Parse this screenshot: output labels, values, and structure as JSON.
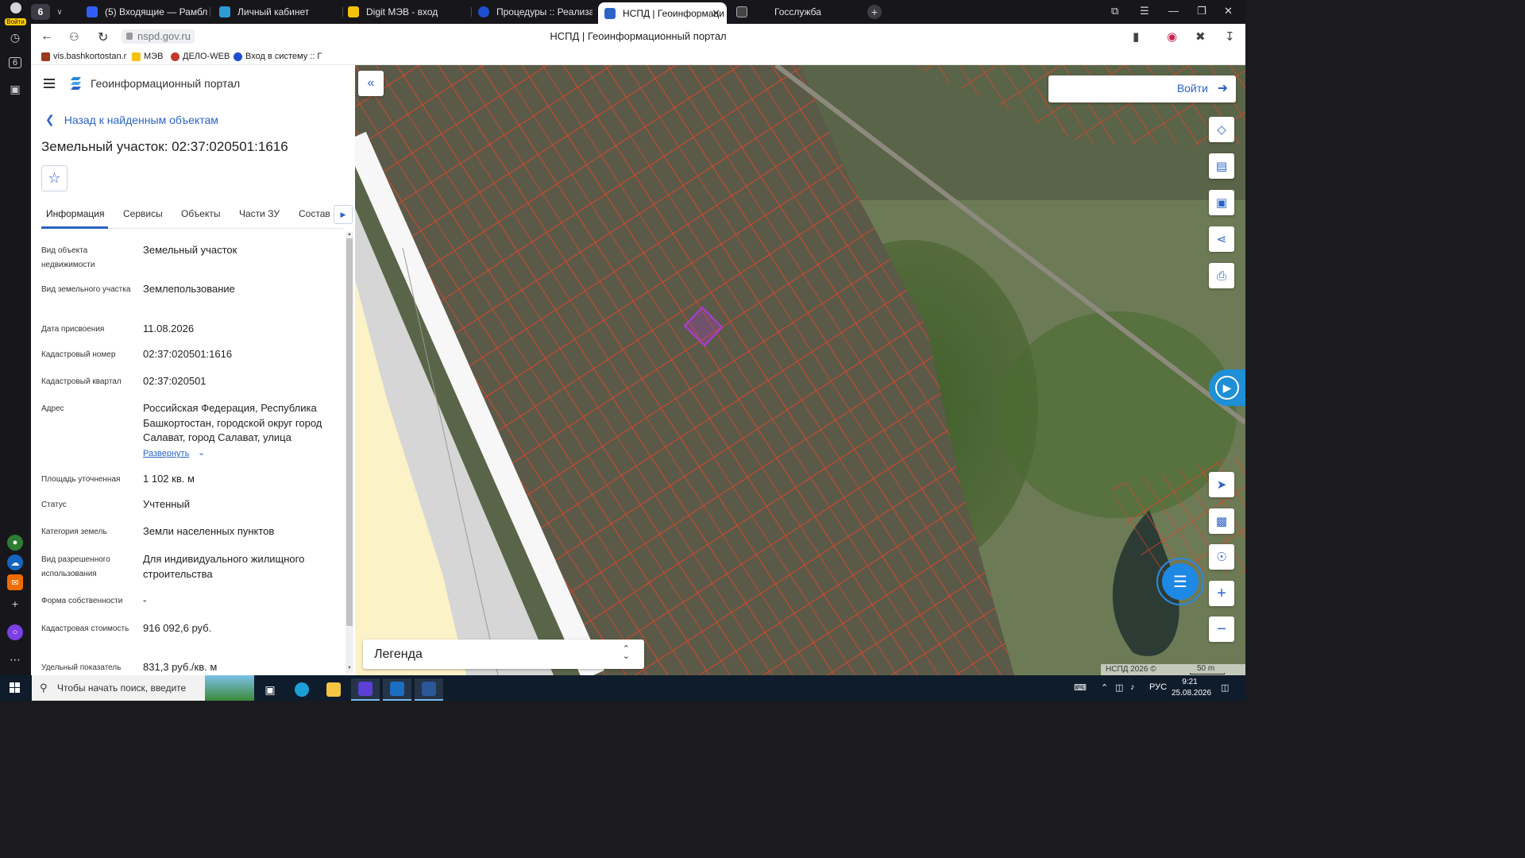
{
  "rail": {
    "login_label": "Войти",
    "counter": "6"
  },
  "tabs": {
    "counter": "6",
    "items": [
      {
        "label": "(5) Входящие — Рамблер",
        "color": "#315efb"
      },
      {
        "label": "Личный кабинет",
        "color": "#2e9bd6"
      },
      {
        "label": "Digit МЭВ - вход",
        "color": "#f4c20d"
      },
      {
        "label": "Процедуры :: Реализация",
        "color": "#1f4fd1"
      },
      {
        "label": "НСПД | Геоинформаци",
        "color": "#2a64c6"
      },
      {
        "label": "Госслужба",
        "color": "#444444"
      }
    ]
  },
  "addressbar": {
    "url": "nspd.gov.ru",
    "page_title": "НСПД | Геоинформационный портал"
  },
  "bookmarks": [
    {
      "label": "vis.bashkortostan.r",
      "color": "#9b3a1a"
    },
    {
      "label": "МЭВ",
      "color": "#f4c20d"
    },
    {
      "label": "ДЕЛО-WEB",
      "color": "#c0392b"
    },
    {
      "label": "Вход в систему :: Г",
      "color": "#1f4fd1"
    }
  ],
  "panel": {
    "portal_name": "Геоинформационный портал",
    "back_link": "Назад к найденным объектам",
    "object_title": "Земельный участок: 02:37:020501:1616",
    "tabs": [
      "Информация",
      "Сервисы",
      "Объекты",
      "Части ЗУ",
      "Состав"
    ],
    "expand_label": "Развернуть",
    "rows": [
      {
        "label": "Вид объекта недвижимости",
        "value": "Земельный участок"
      },
      {
        "label": "Вид земельного участка",
        "value": "Землепользование"
      },
      {
        "label": "Дата присвоения",
        "value": "11.08.2026"
      },
      {
        "label": "Кадастровый номер",
        "value": "02:37:020501:1616"
      },
      {
        "label": "Кадастровый квартал",
        "value": "02:37:020501"
      },
      {
        "label": "Адрес",
        "value": "Российская Федерация, Республика Башкортостан, городской округ город Салават, город Салават, улица"
      },
      {
        "label": "Площадь уточненная",
        "value": "1 102 кв. м"
      },
      {
        "label": "Статус",
        "value": "Учтенный"
      },
      {
        "label": "Категория земель",
        "value": "Земли населенных пунктов"
      },
      {
        "label": "Вид разрешенного использования",
        "value": "Для индивидуального жилищного строительства"
      },
      {
        "label": "Форма собственности",
        "value": "-"
      },
      {
        "label": "Кадастровая стоимость",
        "value": "916 092,6 руб."
      },
      {
        "label": "Удельный показатель",
        "value": "831,3 руб./кв. м"
      }
    ]
  },
  "map": {
    "login_label": "Войти",
    "legend_label": "Легенда",
    "copyright": "НСПД 2026 ©",
    "scale_label": "50 m",
    "parcel_color": "#e0442b",
    "selected_color": "#b03ad6"
  },
  "taskbar": {
    "search_placeholder": "Чтобы начать поиск, введите",
    "lang": "РУС",
    "time": "9:21",
    "date": "25.08.2026"
  }
}
